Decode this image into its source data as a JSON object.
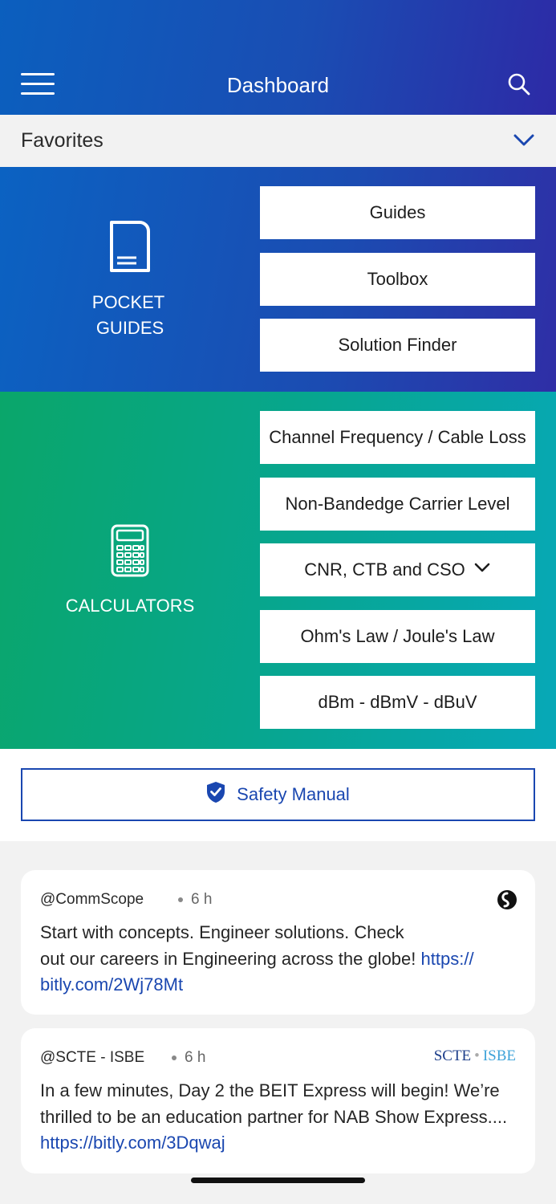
{
  "header": {
    "title": "Dashboard",
    "menu_icon": "hamburger-menu-icon",
    "search_icon": "search-icon"
  },
  "favorites": {
    "label": "Favorites",
    "chevron_icon": "chevron-down-icon"
  },
  "pocket_guides": {
    "label_line1": "POCKET",
    "label_line2": "GUIDES",
    "icon": "document-icon",
    "buttons": [
      "Guides",
      "Toolbox",
      "Solution Finder"
    ]
  },
  "calculators": {
    "label": "CALCULATORS",
    "icon": "calculator-icon",
    "buttons": [
      "Channel Frequency / Cable Loss",
      "Non-Bandedge Carrier Level",
      "CNR, CTB and CSO",
      "Ohm's Law / Joule's Law",
      "dBm - dBmV - dBuV"
    ]
  },
  "safety": {
    "label": "Safety Manual",
    "icon": "shield-check-icon"
  },
  "feed": [
    {
      "handle": "@CommScope",
      "time": "6 h",
      "text_line1": "Start with concepts. Engineer solutions. Check",
      "text_line2": "out our careers in Engineering across the globe!",
      "link_part1": "https://",
      "link_part2": "bitly.com/2Wj78Mt",
      "logo": "commscope-logo-icon"
    },
    {
      "handle": "@SCTE - ISBE",
      "time": "6 h",
      "text_line1": "In a few minutes, Day 2 the BEIT Express will begin!   We’re",
      "text_line2": "thrilled to be an education partner for NAB Show Express....",
      "link": "https://bitly.com/3Dqwaj",
      "logo_a": "SCTE",
      "logo_dot": "•",
      "logo_b": "ISBE"
    }
  ],
  "colors": {
    "header_start": "#0b5fbe",
    "header_end": "#2d2aa6",
    "calc_start": "#0aa66a",
    "calc_end": "#07a8b8",
    "accent_blue": "#1a47b0"
  }
}
